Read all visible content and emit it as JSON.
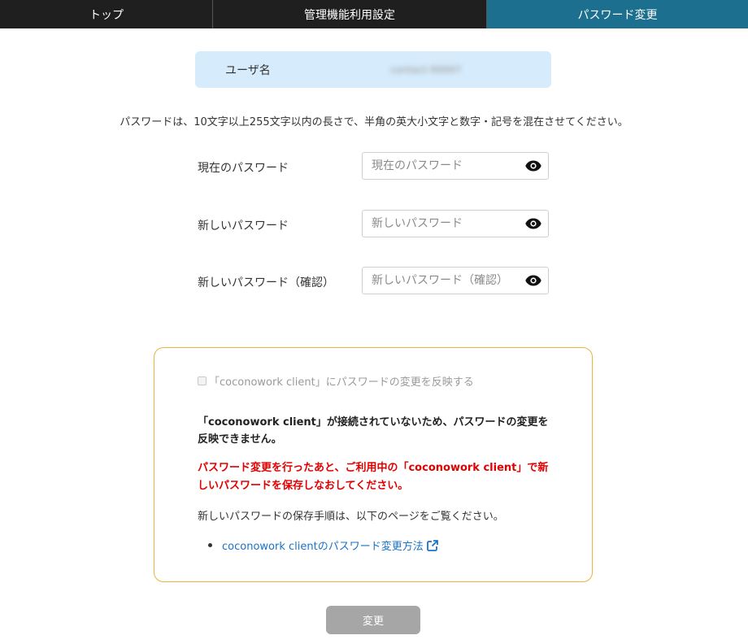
{
  "nav": {
    "top": "トップ",
    "admin": "管理機能利用設定",
    "password": "パスワード変更"
  },
  "user": {
    "label": "ユーザ名",
    "value": "contact-99997"
  },
  "instruction": "パスワードは、10文字以上255文字以内の長さで、半角の英大小文字と数字・記号を混在させてください。",
  "form": {
    "current_label": "現在のパスワード",
    "current_placeholder": "現在のパスワード",
    "new_label": "新しいパスワード",
    "new_placeholder": "新しいパスワード",
    "confirm_label": "新しいパスワード（確認）",
    "confirm_placeholder": "新しいパスワード（確認）"
  },
  "notice": {
    "sync_label": "「coconowork client」にパスワードの変更を反映する",
    "warning_bold": "「coconowork client」が接続されていないため、パスワードの変更を反映できません。",
    "warning_red": "パスワード変更を行ったあと、ご利用中の「coconowork client」で新しいパスワードを保存しなおしてください。",
    "guide": "新しいパスワードの保存手順は、以下のページをご覧ください。",
    "link_label": "coconowork clientのパスワード変更方法"
  },
  "submit_label": "変更",
  "icons": {
    "eye": "eye-icon",
    "external_link": "external-link-icon"
  },
  "colors": {
    "nav_bg": "#1f1f1f",
    "nav_active": "#1c6f8e",
    "user_box_bg": "#d6ebfb",
    "notice_border": "#e8b43a",
    "warning_red": "#e00000",
    "link": "#1a73c9",
    "button_disabled": "#a6a6a6"
  }
}
